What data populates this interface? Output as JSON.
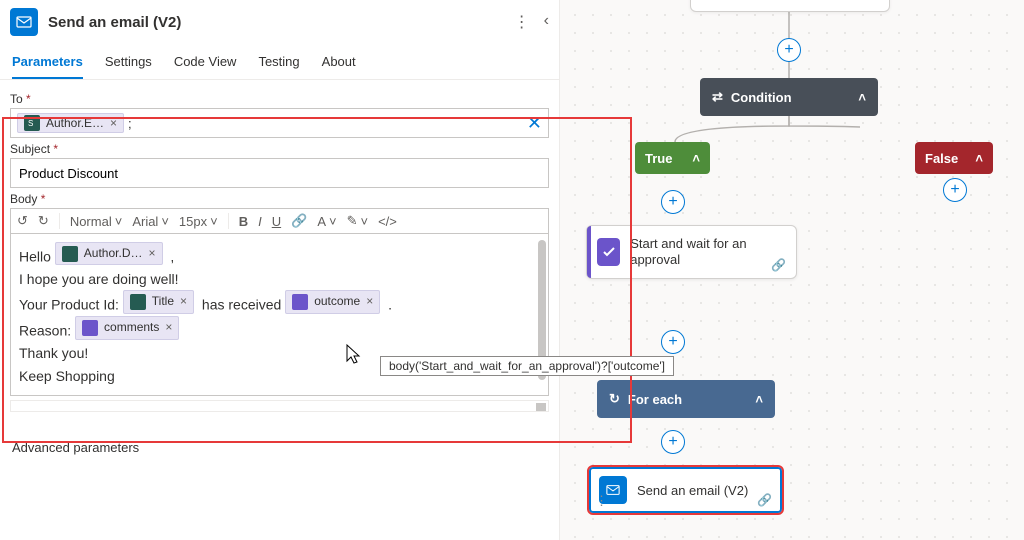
{
  "header": {
    "title": "Send an email (V2)"
  },
  "tabs": [
    "Parameters",
    "Settings",
    "Code View",
    "Testing",
    "About"
  ],
  "activeTab": "Parameters",
  "fields": {
    "to_label": "To",
    "subject_label": "Subject",
    "body_label": "Body",
    "subject_value": "Product Discount",
    "to_pill": "Author.E…",
    "to_separator": ";"
  },
  "toolbar": {
    "undo": "↺",
    "redo": "↻",
    "style": "Normal",
    "font": "Arial",
    "size": "15px"
  },
  "body": {
    "hello": "Hello",
    "author_pill": "Author.D…",
    "comma": ",",
    "line2": "I hope you are doing well!",
    "line3a": "Your Product Id:",
    "title_pill": "Title",
    "line3b": "has received",
    "outcome_pill": "outcome",
    "period": ".",
    "line4a": "Reason:",
    "comments_pill": "comments",
    "line5": "Thank you!",
    "line6": "Keep Shopping"
  },
  "tooltip": "body('Start_and_wait_for_an_approval')?['outcome']",
  "advanced": "Advanced parameters",
  "flow": {
    "condition": "Condition",
    "true": "True",
    "false": "False",
    "approval": "Start and wait for an approval",
    "foreach": "For each",
    "sendEmail": "Send an email (V2)"
  }
}
